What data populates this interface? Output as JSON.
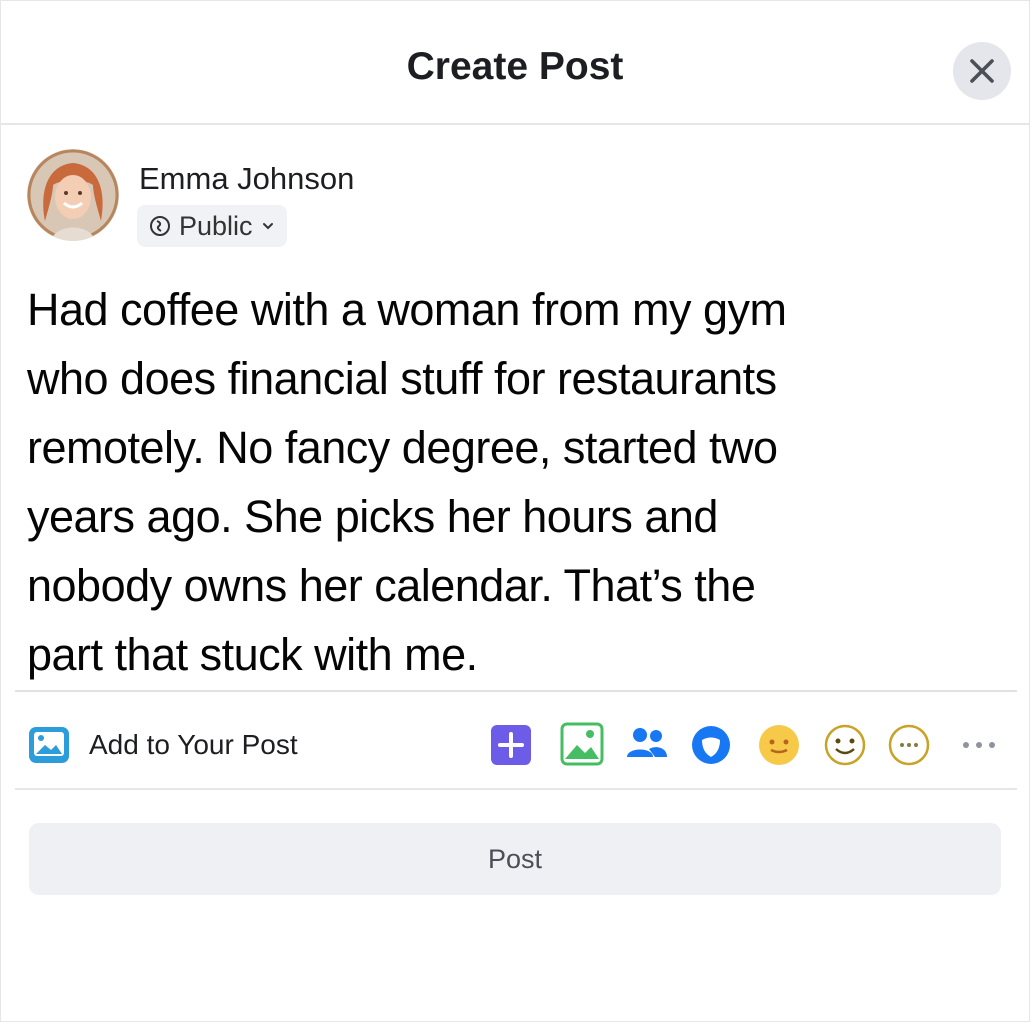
{
  "dialog": {
    "title": "Create Post",
    "close_icon": "close-icon"
  },
  "author": {
    "name": "Emma Johnson",
    "privacy_label": "Public",
    "privacy_icon": "globe-icon",
    "dropdown_icon": "chevron-down-icon"
  },
  "post": {
    "lines": [
      "Had coffee with a woman from my gym",
      "who does financial stuff for restaurants",
      "remotely. No fancy degree, started two",
      "years ago. She picks her hours and",
      "nobody owns her calendar. That’s the",
      "part that stuck with me."
    ]
  },
  "add_to_post": {
    "label": "Add to Your Post",
    "icon": "photo-frame-icon",
    "tools": [
      "plus-icon",
      "image-icon",
      "tag-people-icon",
      "location-icon",
      "feeling-icon",
      "smiley-icon",
      "more-circle-icon",
      "more-icon"
    ]
  },
  "actions": {
    "post_label": "Post"
  },
  "colors": {
    "accent_blue": "#1877f2",
    "button_bg": "#eef0f3",
    "purple": "#6c5ce7",
    "green": "#45bd62",
    "yellow": "#f7c948"
  }
}
